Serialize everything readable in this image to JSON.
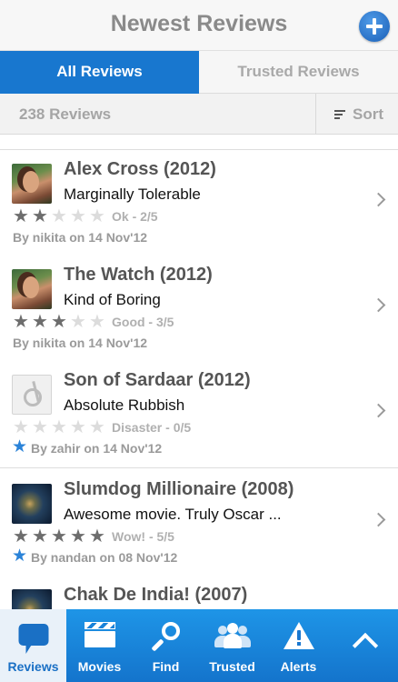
{
  "header": {
    "title": "Newest Reviews",
    "add_icon": "plus-circle-icon"
  },
  "tabs": [
    {
      "label": "All Reviews",
      "active": true
    },
    {
      "label": "Trusted Reviews",
      "active": false
    }
  ],
  "subbar": {
    "count": "238 Reviews",
    "sort_label": "Sort",
    "sort_icon": "sort-lines-icon"
  },
  "reviews": [
    {
      "movie": "Alex Cross (2012)",
      "headline": "Marginally Tolerable",
      "stars": 2,
      "max_stars": 5,
      "rating_text": "Ok - 2/5",
      "byline": "By nikita on 14 Nov'12",
      "trusted": false,
      "thumb": "girl"
    },
    {
      "movie": "The Watch (2012)",
      "headline": "Kind of Boring",
      "stars": 3,
      "max_stars": 5,
      "rating_text": "Good - 3/5",
      "byline": "By nikita on 14 Nov'12",
      "trusted": false,
      "thumb": "girl"
    },
    {
      "movie": "Son of Sardaar (2012)",
      "headline": "Absolute Rubbish",
      "stars": 0,
      "max_stars": 5,
      "rating_text": "Disaster - 0/5",
      "byline": "By zahir on 14 Nov'12",
      "trusted": true,
      "thumb": "logo"
    },
    {
      "movie": "Slumdog Millionaire (2008)",
      "headline": "Awesome movie. Truly Oscar ...",
      "stars": 5,
      "max_stars": 5,
      "rating_text": "Wow! - 5/5",
      "byline": "By nandan on 08 Nov'12",
      "trusted": true,
      "thumb": "night"
    },
    {
      "movie": "Chak De India! (2007)",
      "headline": "",
      "stars": 0,
      "max_stars": 5,
      "rating_text": "",
      "byline": "",
      "trusted": false,
      "thumb": "night"
    }
  ],
  "tabbar": [
    {
      "label": "Reviews",
      "icon": "speech-bubble-icon",
      "active": true
    },
    {
      "label": "Movies",
      "icon": "clapperboard-icon",
      "active": false
    },
    {
      "label": "Find",
      "icon": "magnifier-icon",
      "active": false
    },
    {
      "label": "Trusted",
      "icon": "people-icon",
      "active": false
    },
    {
      "label": "Alerts",
      "icon": "warning-icon",
      "active": false
    },
    {
      "label": "",
      "icon": "chevron-up-icon",
      "active": false
    }
  ],
  "colors": {
    "accent": "#1877cf",
    "trusted_star": "#2b83d8"
  }
}
